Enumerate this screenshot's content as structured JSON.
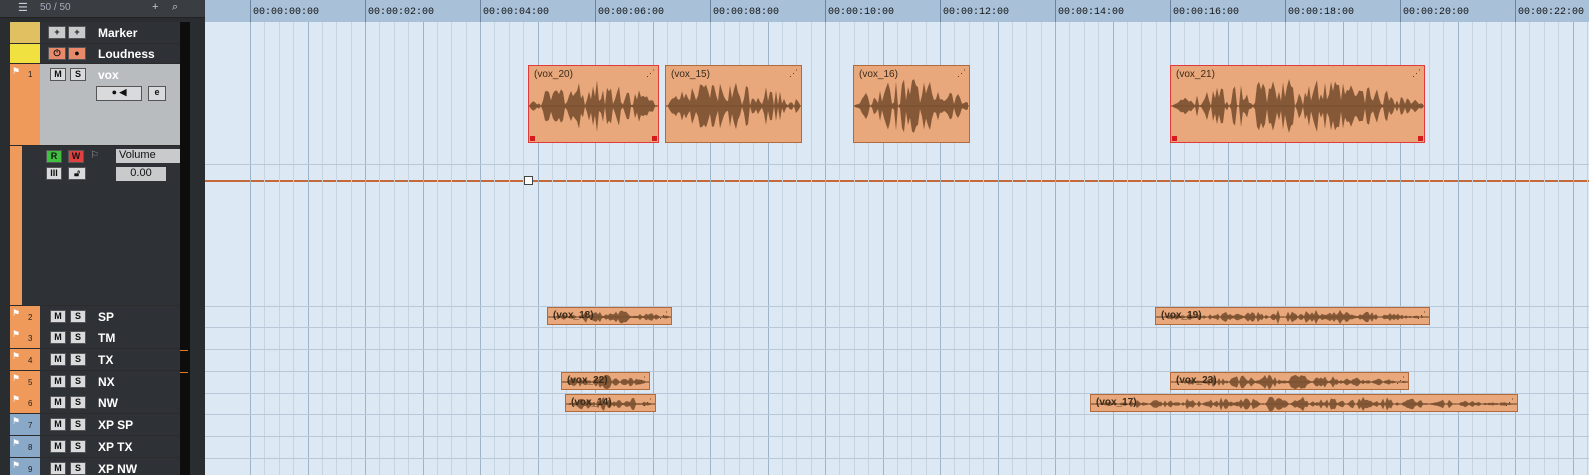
{
  "header": {
    "counter": "50 / 50"
  },
  "tracks": {
    "marker": {
      "name": "Marker"
    },
    "loudness": {
      "name": "Loudness"
    },
    "vox": {
      "num": "1",
      "name": "vox"
    },
    "automation": {
      "read": "R",
      "write": "W",
      "param": "Volume",
      "value": "0.00"
    },
    "sp": {
      "num": "2",
      "name": "SP"
    },
    "tm": {
      "num": "3",
      "name": "TM"
    },
    "tx": {
      "num": "4",
      "name": "TX"
    },
    "nx": {
      "num": "5",
      "name": "NX"
    },
    "nw": {
      "num": "6",
      "name": "NW"
    },
    "xpsp": {
      "num": "7",
      "name": "XP SP"
    },
    "xptx": {
      "num": "8",
      "name": "XP  TX"
    },
    "xpnw": {
      "num": "9",
      "name": "XP  NW"
    }
  },
  "buttons": {
    "mute": "M",
    "solo": "S",
    "edit": "e"
  },
  "ruler": {
    "labels": [
      "00:00:00:00",
      "00:00:02:00",
      "00:00:04:00",
      "00:00:06:00",
      "00:00:08:00",
      "00:00:10:00",
      "00:00:12:00",
      "00:00:14:00",
      "00:00:16:00",
      "00:00:18:00",
      "00:00:20:00",
      "00:00:22:00"
    ]
  },
  "events": {
    "vox20": "(vox_20)",
    "vox15": "(vox_15)",
    "vox16": "(vox_16)",
    "vox21": "(vox_21)",
    "vox18": "(vox_18)",
    "vox19": "(vox_19)",
    "vox22": "(vox_22)",
    "vox23": "(vox_23)",
    "vox14": "(vox_14)",
    "vox17": "(vox_17)"
  },
  "colors": {
    "track_orange": "#ef9a5a",
    "event_fill": "#e8a87c",
    "lane_bg": "#dce8f4",
    "selected_marker": "#d41c1c"
  }
}
